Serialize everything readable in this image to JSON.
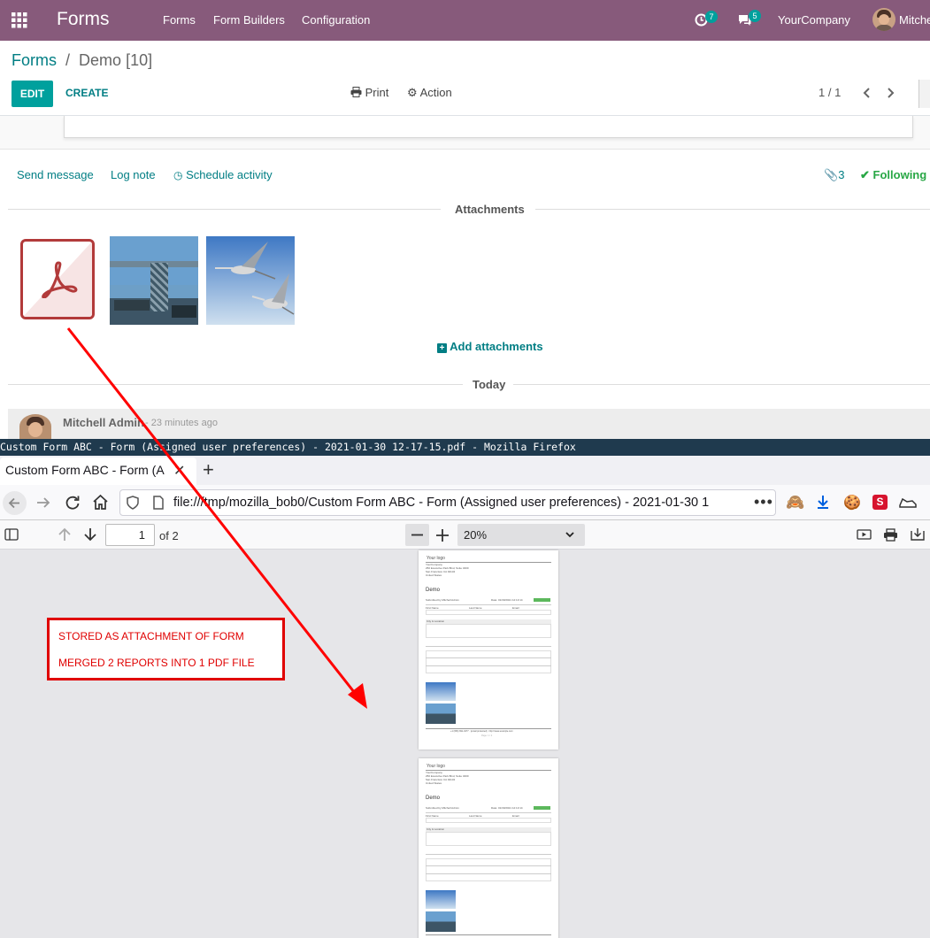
{
  "navbar": {
    "app_title": "Forms",
    "menu": [
      "Forms",
      "Form Builders",
      "Configuration"
    ],
    "activity_count": "7",
    "message_count": "5",
    "company": "YourCompany",
    "user": "Mitche"
  },
  "breadcrumb": {
    "root": "Forms",
    "separator": "/",
    "current": "Demo [10]"
  },
  "control": {
    "edit": "EDIT",
    "create": "CREATE",
    "print": "Print",
    "action": "Action",
    "pager": "1 / 1"
  },
  "chatter": {
    "send_message": "Send message",
    "log_note": "Log note",
    "schedule_activity": "Schedule activity",
    "attachment_count": "3",
    "following": "Following",
    "attachments_title": "Attachments",
    "add_attachments": "Add attachments",
    "today": "Today",
    "author": "Mitchell Admin",
    "time": "- 23 minutes ago"
  },
  "annotation": {
    "line1": "STORED AS ATTACHMENT OF FORM",
    "line2": "MERGED 2 REPORTS INTO 1 PDF FILE",
    "color": "#e00000"
  },
  "firefox": {
    "window_title": "Custom Form ABC - Form (Assigned user preferences) - 2021-01-30 12-17-15.pdf - Mozilla Firefox",
    "tab_title": "Custom Form ABC - Form (A",
    "url": "file:///tmp/mozilla_bob0/Custom Form ABC - Form (Assigned user preferences) - 2021-01-30 1",
    "page_number": "1",
    "page_total": "of 2",
    "zoom": "20%"
  },
  "pdf": {
    "logo": "Your logo",
    "company_lines": [
      "YourCompany",
      "250 Executive Park Blvd, Suite 3400",
      "San Francisco CA 94134",
      "United States"
    ],
    "form_title": "Demo",
    "submitted_by": "Submitted by Mitchell Admin",
    "date": "Date: 01/30/2021 12:13:14",
    "state": "Form Completed",
    "fields": [
      "First Name",
      "Last Name",
      "Email"
    ],
    "values": [
      "Bob",
      "Builder",
      "[email protected]"
    ],
    "section": "City & Location",
    "footer": "+1 (650) 691-3277 · [email protected] · http://www.example.com",
    "page_label": "Page: 1 / 2"
  },
  "colors": {
    "brand": "#875a7b",
    "teal": "#017e84",
    "following": "#28a745",
    "pdf_red": "#b23a3a"
  }
}
